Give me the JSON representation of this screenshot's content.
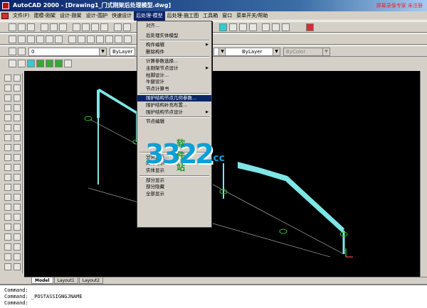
{
  "title": "AutoCAD 2000 - [Drawing1_门式刚架后处理模型.dwg]",
  "watermark": "屏幕录像专家 未注册",
  "menubar": [
    "文件(F)",
    "建模-刚架",
    "设计-刚架",
    "设计-围护",
    "快速设计",
    "后处理-模型",
    "后处理-施工图",
    "工具箱",
    "窗口",
    "菜单开关/帮助"
  ],
  "active_menu_index": 5,
  "toolbar": {
    "layer_value": "0",
    "linetype_1": "ByLayer",
    "linetype_2": "ByLayer",
    "color": "ByColor"
  },
  "dropdown": {
    "items": [
      {
        "label": "对齐...",
        "sub": false
      },
      {
        "label": "后处理实体模型",
        "sub": false
      },
      {
        "label": "构件编辑",
        "sub": true
      },
      {
        "label": "删除构件",
        "sub": false
      },
      {
        "label": "计算参数选择...",
        "sub": false
      },
      {
        "label": "主刚架节点设计",
        "sub": true
      },
      {
        "label": "柱脚设计...",
        "sub": false
      },
      {
        "label": "牛腿设计",
        "sub": false
      },
      {
        "label": "节点计算书",
        "sub": false
      },
      {
        "label": "围护结构节点几何参数...",
        "sub": false
      },
      {
        "label": "围护结构补充布置...",
        "sub": false
      },
      {
        "label": "围护结构节点设计",
        "sub": true
      },
      {
        "label": "节点编辑",
        "sub": false
      },
      {
        "label": "分类显示...",
        "sub": false
      },
      {
        "label": "简化显示",
        "sub": false
      },
      {
        "label": "实体显示",
        "sub": false
      },
      {
        "label": "部分显示",
        "sub": false
      },
      {
        "label": "部分隐藏",
        "sub": false
      },
      {
        "label": "全部显示",
        "sub": false
      }
    ],
    "highlighted_index": 9
  },
  "tabs": [
    "Model",
    "Layout1",
    "Layout2"
  ],
  "active_tab_index": 0,
  "command_lines": [
    "Command:",
    "Command:  _POSTASSIGNGJNAME",
    "Command:"
  ],
  "logo": {
    "big": "3322",
    "small": "软件站",
    "cc": ".cc"
  },
  "colors": {
    "beam": "#7ee6e6",
    "node": "#2bbf2b",
    "highlight": "#0a246a"
  }
}
